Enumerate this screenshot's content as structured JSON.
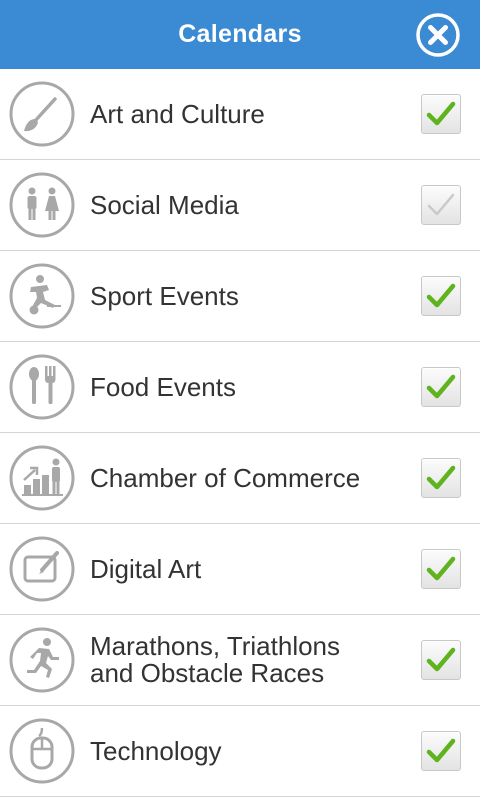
{
  "header": {
    "title": "Calendars"
  },
  "calendars": [
    {
      "label": "Art and Culture",
      "icon": "paintbrush-icon",
      "checked": true
    },
    {
      "label": "Social Media",
      "icon": "people-icon",
      "checked": false
    },
    {
      "label": "Sport Events",
      "icon": "soccer-player-icon",
      "checked": true
    },
    {
      "label": "Food Events",
      "icon": "spoon-fork-icon",
      "checked": true
    },
    {
      "label": "Chamber of Commerce",
      "icon": "business-growth-icon",
      "checked": true
    },
    {
      "label": "Digital Art",
      "icon": "drawing-tablet-icon",
      "checked": true
    },
    {
      "label": "Marathons, Triathlons and Obstacle Races",
      "icon": "runner-icon",
      "checked": true
    },
    {
      "label": "Technology",
      "icon": "computer-mouse-icon",
      "checked": true
    }
  ],
  "colors": {
    "header": "#3b8ad4",
    "check_on": "#5fb31e",
    "check_off": "#c9c9c9",
    "icon_gray": "#a8a8a8"
  }
}
